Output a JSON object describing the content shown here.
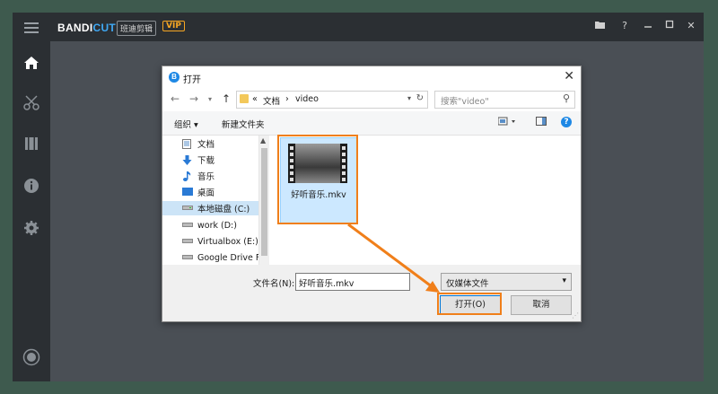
{
  "app": {
    "brand_main": "BANDI",
    "brand_accent": "CUT",
    "brand_cn": "班迪剪辑",
    "vip_badge": "VIP",
    "window_controls": [
      "folder-icon",
      "help-icon",
      "minimize-icon",
      "maximize-icon",
      "close-icon"
    ],
    "help_glyph": "?",
    "close_glyph": "✕",
    "sidebar_icons": [
      "menu-icon",
      "home-icon",
      "cut-icon",
      "film-icon",
      "info-icon",
      "gear-icon",
      "record-icon"
    ]
  },
  "dialog": {
    "icon_letter": "B",
    "title": "打开",
    "close_glyph": "✕",
    "address": {
      "prefix": "«",
      "segments": [
        "文档",
        "video"
      ],
      "separator": "›",
      "refresh_glyph": "↻"
    },
    "search_placeholder": "搜索\"video\"",
    "toolbar": {
      "organize": "组织 ▾",
      "new_folder": "新建文件夹",
      "help_glyph": "?"
    },
    "tree": [
      {
        "label": "文档",
        "icon": "documents-icon"
      },
      {
        "label": "下载",
        "icon": "download-icon"
      },
      {
        "label": "音乐",
        "icon": "music-icon"
      },
      {
        "label": "桌面",
        "icon": "desktop-icon"
      },
      {
        "label": "本地磁盘 (C:)",
        "icon": "drive-icon",
        "selected": true
      },
      {
        "label": "work (D:)",
        "icon": "drive-icon"
      },
      {
        "label": "Virtualbox (E:)",
        "icon": "drive-icon"
      },
      {
        "label": "Google Drive F",
        "icon": "drive-icon"
      }
    ],
    "file": {
      "name": "好听音乐.mkv",
      "icon": "video-file-icon"
    },
    "filename_label": "文件名(N):",
    "filename_value": "好听音乐.mkv",
    "filter": "仅媒体文件",
    "open_button": "打开(O)",
    "cancel_button": "取消"
  },
  "colors": {
    "highlight": "#f07f1a",
    "accent": "#3fa9f5",
    "vip": "#f5a623",
    "background": "#3e5a4e"
  }
}
